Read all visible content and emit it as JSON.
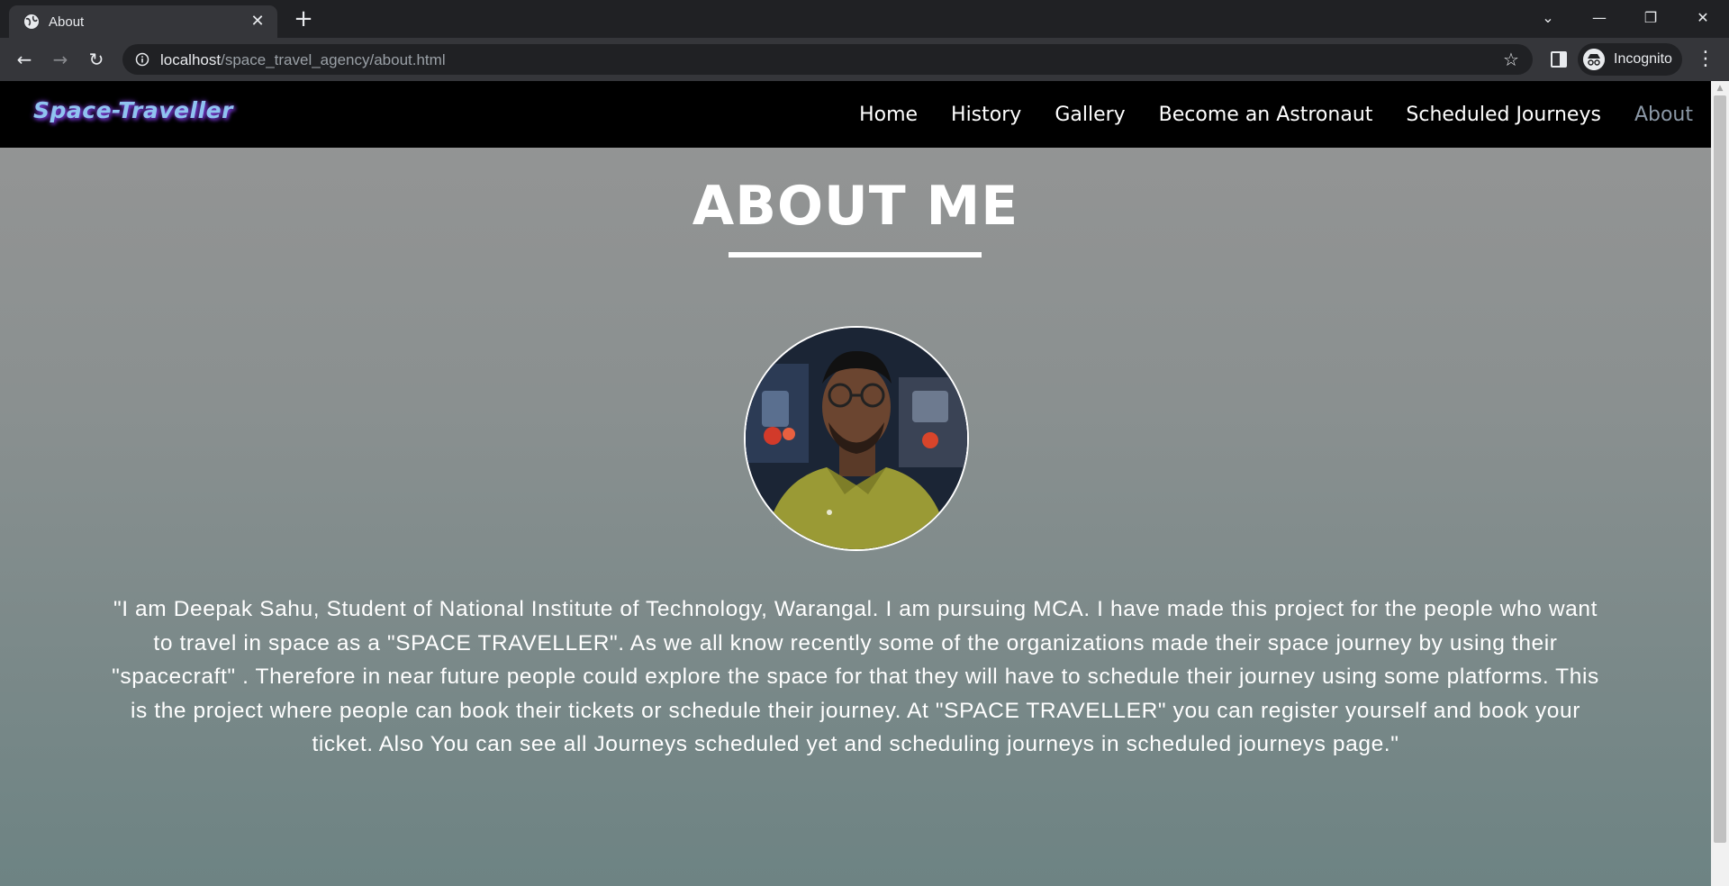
{
  "browser": {
    "tab_title": "About",
    "url_host": "localhost",
    "url_path": "/space_travel_agency/about.html",
    "profile_label": "Incognito"
  },
  "site": {
    "brand": "Space-Traveller",
    "nav": [
      {
        "label": "Home",
        "active": false
      },
      {
        "label": "History",
        "active": false
      },
      {
        "label": "Gallery",
        "active": false
      },
      {
        "label": "Become an Astronaut",
        "active": false
      },
      {
        "label": "Scheduled Journeys",
        "active": false
      },
      {
        "label": "About",
        "active": true
      }
    ]
  },
  "about": {
    "heading": "ABOUT ME",
    "photo_alt": "profile photo",
    "bio": "\"I am Deepak Sahu, Student of National Institute of Technology, Warangal. I am pursuing MCA. I have made this project for the people who want to travel in space as a \"SPACE TRAVELLER\". As we all know recently some of the organizations made their space journey by using their \"spacecraft\" . Therefore in near future people could explore the space for that they will have to schedule their journey using some platforms. This is the project where people can book their tickets or schedule their journey. At \"SPACE TRAVELLER\" you can register yourself and book your ticket. Also You can see all Journeys scheduled yet and scheduling journeys in scheduled journeys page.\""
  },
  "colors": {
    "nav_bg": "#000000",
    "brand_text": "#8fc3f0",
    "brand_glow": "#7a3fd0",
    "active_nav": "#8b98a6",
    "page_gradient_top": "#959595",
    "page_gradient_bottom": "#6d8383"
  }
}
